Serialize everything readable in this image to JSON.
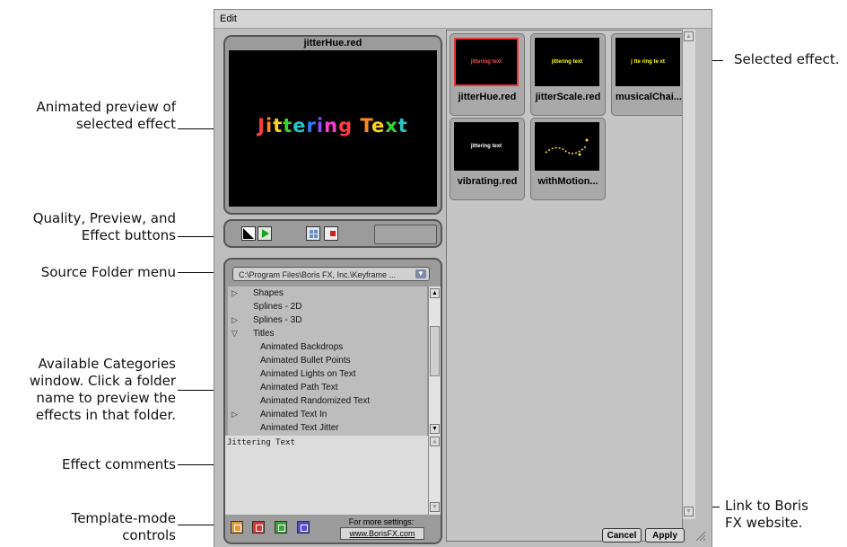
{
  "menubar": {
    "edit": "Edit"
  },
  "preview": {
    "title": "jitterHue.red",
    "text": "Jittering Text",
    "letter_colors": [
      "#ff3b3b",
      "#ff8a1f",
      "#ffd21f",
      "#39d430",
      "#27c6c6",
      "#2d7bff",
      "#8a4dff",
      "#ff3bd2",
      "#ff3b3b",
      "#ff8a1f",
      "#ffd21f",
      "#39d430",
      "#27c6c6",
      "#2d7bff"
    ]
  },
  "source_folder": {
    "value": "C:\\Program Files\\Boris FX, Inc.\\Keyframe ..."
  },
  "categories": [
    {
      "label": "Shapes",
      "indent": 0,
      "twisty": "▷"
    },
    {
      "label": "Splines - 2D",
      "indent": 0,
      "twisty": ""
    },
    {
      "label": "Splines - 3D",
      "indent": 0,
      "twisty": "▷"
    },
    {
      "label": "Titles",
      "indent": 0,
      "twisty": "▽"
    },
    {
      "label": "Animated Backdrops",
      "indent": 1,
      "twisty": ""
    },
    {
      "label": "Animated Bullet Points",
      "indent": 1,
      "twisty": ""
    },
    {
      "label": "Animated Lights on Text",
      "indent": 1,
      "twisty": ""
    },
    {
      "label": "Animated Path Text",
      "indent": 1,
      "twisty": ""
    },
    {
      "label": "Animated Randomized Text",
      "indent": 1,
      "twisty": ""
    },
    {
      "label": "Animated Text In",
      "indent": 1,
      "twisty": "▷"
    },
    {
      "label": "Animated Text Jitter",
      "indent": 1,
      "twisty": ""
    }
  ],
  "comments": {
    "text": "Jittering Text"
  },
  "more_settings": {
    "label": "For more settings:",
    "link": "www.BorisFX.com"
  },
  "effects": [
    {
      "name": "jitterHue.red",
      "thumb": "jittering text",
      "selected": true
    },
    {
      "name": "jitterScale.red",
      "thumb": "jittering text",
      "selected": false
    },
    {
      "name": "musicalChai...",
      "thumb": "j tte ring te xt",
      "selected": false
    },
    {
      "name": "vibrating.red",
      "thumb": "jittering text",
      "selected": false
    },
    {
      "name": "withMotion...",
      "thumb": "",
      "selected": false
    }
  ],
  "buttons": {
    "cancel": "Cancel",
    "apply": "Apply"
  },
  "callouts": {
    "animated_preview": "Animated preview of\nselected effect",
    "quality": "Quality, Preview, and\nEffect buttons",
    "source_folder": "Source Folder menu",
    "categories": "Available Categories\nwindow. Click a folder\nname to preview the\neffects in that folder.",
    "comments": "Effect comments",
    "template": "Template-mode\ncontrols",
    "selected_effect": "Selected effect.",
    "link": "Link to Boris\nFX website."
  }
}
